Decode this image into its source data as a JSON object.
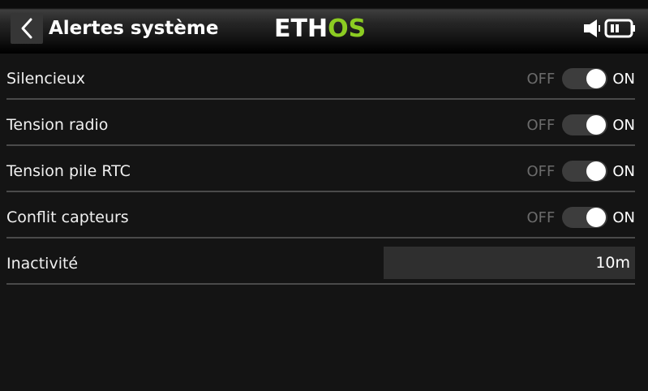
{
  "header": {
    "title": "Alertes système",
    "logo_main": "ETH",
    "logo_accent": "OS",
    "accent_color": "#8ccc22"
  },
  "rows": [
    {
      "label": "Silencieux",
      "off": "OFF",
      "on": "ON",
      "state": "on"
    },
    {
      "label": "Tension radio",
      "off": "OFF",
      "on": "ON",
      "state": "on"
    },
    {
      "label": "Tension pile RTC",
      "off": "OFF",
      "on": "ON",
      "state": "on"
    },
    {
      "label": "Conflit capteurs",
      "off": "OFF",
      "on": "ON",
      "state": "on"
    },
    {
      "label": "Inactivité",
      "value": "10m"
    }
  ],
  "icons": {
    "back": "chevron-left-icon",
    "speaker": "speaker-icon",
    "battery": "battery-icon"
  }
}
